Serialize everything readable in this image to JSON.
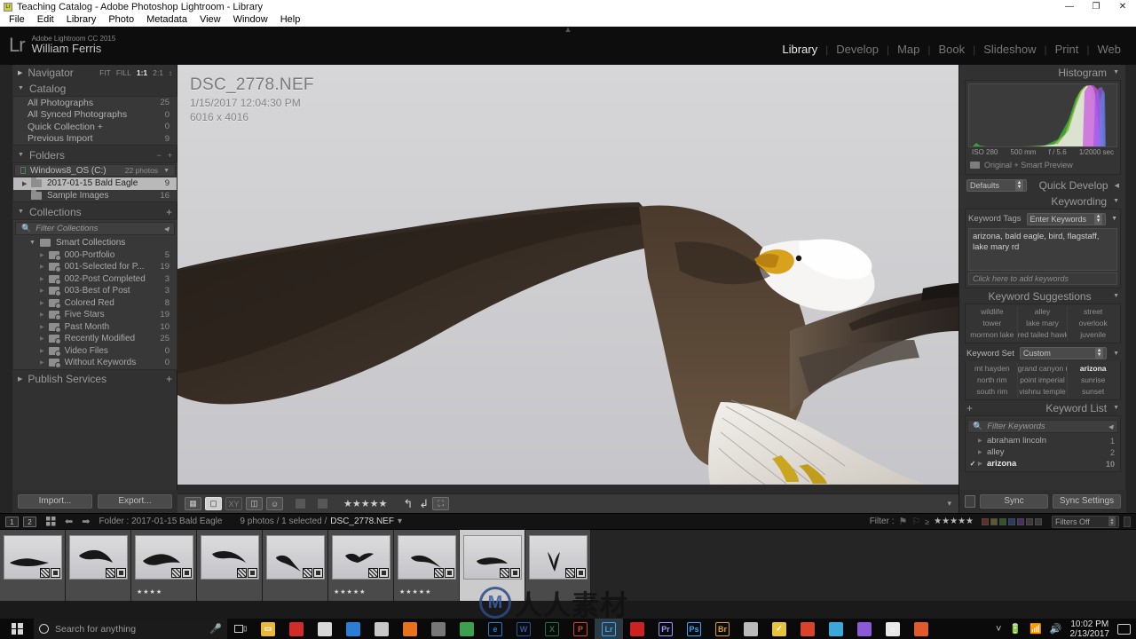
{
  "window": {
    "title": "Teaching Catalog - Adobe Photoshop Lightroom - Library",
    "icon": "lightroom-icon",
    "minimize": "—",
    "maximize": "❐",
    "close": "✕"
  },
  "menubar": {
    "items": [
      "File",
      "Edit",
      "Library",
      "Photo",
      "Metadata",
      "View",
      "Window",
      "Help"
    ]
  },
  "identity": {
    "logo": "Lr",
    "product": "Adobe Lightroom CC 2015",
    "user": "William Ferris"
  },
  "modules": {
    "items": [
      "Library",
      "Develop",
      "Map",
      "Book",
      "Slideshow",
      "Print",
      "Web"
    ],
    "active": "Library"
  },
  "navigator": {
    "title": "Navigator",
    "zoom_levels": [
      "FIT",
      "FILL",
      "1:1",
      "2:1"
    ],
    "active_zoom": "1:1"
  },
  "catalog": {
    "title": "Catalog",
    "items": [
      {
        "label": "All Photographs",
        "count": "25"
      },
      {
        "label": "All Synced Photographs",
        "count": "0"
      },
      {
        "label": "Quick Collection  +",
        "count": "0"
      },
      {
        "label": "Previous Import",
        "count": "9"
      }
    ]
  },
  "folders": {
    "title": "Folders",
    "minus": "−",
    "plus": "+",
    "volume": {
      "label": "Windows8_OS (C:)",
      "info": "22 photos"
    },
    "items": [
      {
        "label": "2017-01-15 Bald Eagle",
        "count": "9",
        "selected": true
      },
      {
        "label": "Sample Images",
        "count": "16",
        "selected": false
      }
    ]
  },
  "collections": {
    "title": "Collections",
    "plus": "+",
    "filter_placeholder": "Filter Collections",
    "smart_group": "Smart Collections",
    "items": [
      {
        "label": "000-Portfolio",
        "count": "5"
      },
      {
        "label": "001-Selected for P...",
        "count": "19"
      },
      {
        "label": "002-Post Completed",
        "count": "3"
      },
      {
        "label": "003-Best of Post",
        "count": "3"
      },
      {
        "label": "Colored Red",
        "count": "8"
      },
      {
        "label": "Five Stars",
        "count": "19"
      },
      {
        "label": "Past Month",
        "count": "10"
      },
      {
        "label": "Recently Modified",
        "count": "25"
      },
      {
        "label": "Video Files",
        "count": "0"
      },
      {
        "label": "Without Keywords",
        "count": "0"
      }
    ]
  },
  "publish_services": {
    "title": "Publish Services",
    "plus": "+"
  },
  "left_buttons": {
    "import": "Import...",
    "export": "Export..."
  },
  "photo": {
    "filename": "DSC_2778.NEF",
    "datetime": "1/15/2017 12:04:30 PM",
    "dimensions": "6016 x 4016"
  },
  "view_toolbar": {
    "grid_icon": "grid-view-icon",
    "loupe_icon": "loupe-view-icon",
    "compare_icon": "compare-view-icon",
    "survey_icon": "survey-view-icon",
    "people_icon": "people-view-icon",
    "flag_pick_icon": "flag-pick-icon",
    "flag_reject_icon": "flag-reject-icon",
    "stars": "★★★★★",
    "rotate_left_icon": "rotate-left-icon",
    "rotate_right_icon": "rotate-right-icon",
    "crop_icon": "crop-overlay-icon",
    "thumbnails_label": ""
  },
  "histogram": {
    "title": "Histogram",
    "iso": "ISO 280",
    "focal": "500 mm",
    "aperture": "f / 5.6",
    "shutter": "1/2000 sec",
    "preview_status": "Original + Smart Preview"
  },
  "quick_develop": {
    "title": "Quick Develop",
    "preset": "Defaults"
  },
  "keywording": {
    "title": "Keywording",
    "tags_label": "Keyword Tags",
    "mode": "Enter Keywords",
    "keywords": "arizona, bald eagle, bird, flagstaff, lake mary rd",
    "add_placeholder": "Click here to add keywords"
  },
  "keyword_suggestions": {
    "title": "Keyword Suggestions",
    "items": [
      "wildlife",
      "alley",
      "street",
      "tower",
      "lake mary",
      "overlook",
      "mormon lake",
      "red tailed hawk",
      "juvenile"
    ]
  },
  "keyword_set": {
    "title": "Keyword Set",
    "selected": "Custom",
    "items": [
      {
        "label": "mt hayden",
        "highlight": false
      },
      {
        "label": "grand canyon np",
        "highlight": false
      },
      {
        "label": "arizona",
        "highlight": true
      },
      {
        "label": "north rim",
        "highlight": false
      },
      {
        "label": "point imperial",
        "highlight": false
      },
      {
        "label": "sunrise",
        "highlight": false
      },
      {
        "label": "south rim",
        "highlight": false
      },
      {
        "label": "vishnu temple",
        "highlight": false
      },
      {
        "label": "sunset",
        "highlight": false
      }
    ]
  },
  "keyword_list": {
    "title": "Keyword List",
    "plus": "+",
    "filter_placeholder": "Filter Keywords",
    "items": [
      {
        "label": "abraham lincoln",
        "count": "1",
        "checked": false
      },
      {
        "label": "alley",
        "count": "2",
        "checked": false
      },
      {
        "label": "arizona",
        "count": "10",
        "checked": true
      }
    ]
  },
  "right_buttons": {
    "sync": "Sync",
    "sync_settings": "Sync Settings"
  },
  "filmstrip_header": {
    "page1": "1",
    "page2": "2",
    "grid_icon": "grid-icon",
    "back_icon": "back-arrow-icon",
    "forward_icon": "forward-arrow-icon",
    "source": "Folder : 2017-01-15 Bald Eagle",
    "status_prefix": "9 photos / 1 selected /",
    "status_file": "DSC_2778.NEF",
    "filter_label": "Filter :",
    "stars": "★★★★★",
    "filter_mode": "Filters Off"
  },
  "filmstrip": {
    "thumbs": [
      {
        "stars": "",
        "selected": false
      },
      {
        "stars": "",
        "selected": false
      },
      {
        "stars": "★★★★",
        "selected": false
      },
      {
        "stars": "",
        "selected": false
      },
      {
        "stars": "",
        "selected": false
      },
      {
        "stars": "★★★★★",
        "selected": false
      },
      {
        "stars": "★★★★★",
        "selected": false
      },
      {
        "stars": "",
        "selected": true
      },
      {
        "stars": "",
        "selected": false
      }
    ]
  },
  "watermark": {
    "mark": "M",
    "text": "人人素材"
  },
  "taskbar": {
    "search_placeholder": "Search for anything",
    "time": "10:02 PM",
    "date": "2/13/2017",
    "apps": [
      {
        "name": "file-explorer-icon",
        "glyph": "▭",
        "color": "#e8b93a",
        "text": ""
      },
      {
        "name": "creative-cloud-icon",
        "glyph": "",
        "color": "#d32a2a",
        "text": ""
      },
      {
        "name": "store-icon",
        "glyph": "",
        "color": "#d8d8d8",
        "text": ""
      },
      {
        "name": "remote-desktop-icon",
        "glyph": "",
        "color": "#2a7fd4",
        "text": ""
      },
      {
        "name": "explorer2-icon",
        "glyph": "",
        "color": "#c8c8c8",
        "text": ""
      },
      {
        "name": "firefox-icon",
        "glyph": "",
        "color": "#e8731b",
        "text": ""
      },
      {
        "name": "webcam-icon",
        "glyph": "",
        "color": "#777",
        "text": ""
      },
      {
        "name": "chrome-icon",
        "glyph": "",
        "color": "#3ca14f",
        "text": ""
      },
      {
        "name": "edge-icon",
        "glyph": "e",
        "color": "#1a7fd4",
        "text": "e"
      },
      {
        "name": "word-icon",
        "glyph": "W",
        "color": "#2b579a",
        "text": "W"
      },
      {
        "name": "excel-icon",
        "glyph": "X",
        "color": "#217346",
        "text": "X"
      },
      {
        "name": "powerpoint-icon",
        "glyph": "P",
        "color": "#d24726",
        "text": "P"
      },
      {
        "name": "lightroom-icon",
        "glyph": "Lr",
        "color": "#31a8ff",
        "text": "Lr"
      },
      {
        "name": "camera-raw-icon",
        "glyph": "",
        "color": "#cc2222",
        "text": ""
      },
      {
        "name": "premiere-icon",
        "glyph": "Pr",
        "color": "#9999ff",
        "text": "Pr"
      },
      {
        "name": "photoshop-icon",
        "glyph": "Ps",
        "color": "#31a8ff",
        "text": "Ps"
      },
      {
        "name": "bridge-icon",
        "glyph": "Br",
        "color": "#d8a020",
        "text": "Br"
      },
      {
        "name": "spiral-icon",
        "glyph": "",
        "color": "#bbbbbb",
        "text": ""
      },
      {
        "name": "check-shield-icon",
        "glyph": "✓",
        "color": "#e8c43a",
        "text": ""
      },
      {
        "name": "flame-icon",
        "glyph": "",
        "color": "#d8432a",
        "text": ""
      },
      {
        "name": "clock-app-icon",
        "glyph": "",
        "color": "#3aa8d8",
        "text": ""
      },
      {
        "name": "pen-icon",
        "glyph": "",
        "color": "#8a5ad8",
        "text": ""
      },
      {
        "name": "home-icon",
        "glyph": "⌂",
        "color": "#e8e8e8",
        "text": ""
      },
      {
        "name": "color-app-icon",
        "glyph": "",
        "color": "#e05a2a",
        "text": ""
      }
    ]
  }
}
